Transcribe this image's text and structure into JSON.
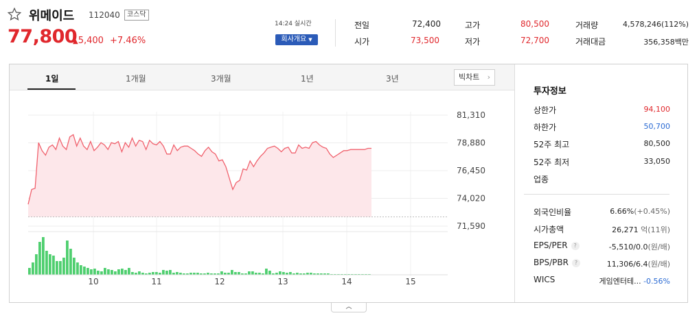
{
  "stock": {
    "name": "위메이드",
    "code": "112040",
    "market": "코스닥",
    "price": "77,800",
    "change": "5,400",
    "change_rate": "+7.46%",
    "realtime_label": "14:24 실시간",
    "company_button": "회사개요"
  },
  "quote": {
    "prev_close_label": "전일",
    "prev_close": "72,400",
    "open_label": "시가",
    "open": "73,500",
    "high_label": "고가",
    "high": "80,500",
    "low_label": "저가",
    "low": "72,700",
    "volume_label": "거래량",
    "volume": "4,578,246(112%)",
    "amount_label": "거래대금",
    "amount": "356,358",
    "amount_unit": "백만"
  },
  "tabs": [
    "1일",
    "1개월",
    "3개월",
    "1년",
    "3년"
  ],
  "big_chart_label": "빅차트",
  "colors": {
    "up": "#e0272c",
    "down": "#2a6ad3",
    "line": "#f0606c",
    "fill": "#fde7ea",
    "volume": "#4fcf6f"
  },
  "chart_data": {
    "type": "line",
    "y_ticks": [
      "81,310",
      "78,880",
      "76,450",
      "74,020",
      "71,590"
    ],
    "ylim": [
      71590,
      81310
    ],
    "x_ticks": [
      "10",
      "11",
      "12",
      "13",
      "14",
      "15"
    ],
    "prev_close_ref": 72400,
    "price_x": [
      0,
      1,
      2,
      3,
      4,
      5,
      6,
      7,
      8,
      9,
      10,
      11,
      12,
      13,
      14,
      15,
      16,
      17,
      18,
      19,
      20,
      21,
      22,
      23,
      24,
      25,
      26,
      27,
      28,
      29,
      30,
      31,
      32,
      33,
      34,
      35,
      36,
      37,
      38,
      39,
      40,
      41,
      42,
      43,
      44,
      45,
      46,
      47,
      48,
      49,
      50,
      51,
      52,
      53,
      54,
      55,
      56,
      57,
      58,
      59,
      60,
      61,
      62,
      63,
      64,
      65,
      66,
      67,
      68,
      69,
      70,
      71,
      72,
      73,
      74,
      75,
      76,
      77,
      78,
      79,
      80,
      81,
      82,
      83,
      84,
      85,
      86,
      87,
      88,
      89,
      90,
      91,
      92,
      93,
      94,
      95,
      96,
      97,
      98,
      99
    ],
    "price": [
      73500,
      74800,
      74900,
      78900,
      78200,
      77800,
      78500,
      78700,
      78300,
      79300,
      78600,
      78300,
      79400,
      79600,
      78600,
      79300,
      78600,
      78300,
      79000,
      78200,
      78500,
      78900,
      78700,
      78300,
      78900,
      78800,
      79000,
      78100,
      78900,
      78500,
      79300,
      78600,
      79100,
      79000,
      78300,
      79100,
      78800,
      78700,
      79000,
      78600,
      77900,
      77900,
      78700,
      78200,
      78500,
      78600,
      78600,
      78400,
      78200,
      77900,
      77700,
      78200,
      78500,
      78100,
      77900,
      77300,
      77400,
      76800,
      75800,
      74800,
      75400,
      75600,
      76600,
      76500,
      77300,
      76800,
      77300,
      77700,
      78000,
      78400,
      78500,
      78600,
      78400,
      78100,
      78400,
      78500,
      78000,
      78000,
      78700,
      78400,
      78500,
      78400,
      78900,
      79000,
      78700,
      78500,
      78400,
      77900,
      77600,
      77800,
      78000,
      78200,
      78200,
      78300,
      78300,
      78300,
      78300,
      78300,
      78400,
      78400
    ],
    "volume_x": [
      0,
      1,
      2,
      3,
      4,
      5,
      6,
      7,
      8,
      9,
      10,
      11,
      12,
      13,
      14,
      15,
      16,
      17,
      18,
      19,
      20,
      21,
      22,
      23,
      24,
      25,
      26,
      27,
      28,
      29,
      30,
      31,
      32,
      33,
      34,
      35,
      36,
      37,
      38,
      39,
      40,
      41,
      42,
      43,
      44,
      45,
      46,
      47,
      48,
      49,
      50,
      51,
      52,
      53,
      54,
      55,
      56,
      57,
      58,
      59,
      60,
      61,
      62,
      63,
      64,
      65,
      66,
      67,
      68,
      69,
      70,
      71,
      72,
      73,
      74,
      75,
      76,
      77,
      78,
      79,
      80,
      81,
      82,
      83,
      84,
      85,
      86,
      87,
      88,
      89,
      90,
      91,
      92,
      93,
      94,
      95,
      96,
      97,
      98,
      99
    ],
    "volume": [
      10,
      18,
      30,
      48,
      55,
      35,
      30,
      28,
      20,
      20,
      25,
      50,
      38,
      25,
      18,
      14,
      12,
      10,
      8,
      9,
      6,
      5,
      10,
      8,
      7,
      5,
      8,
      9,
      7,
      10,
      4,
      3,
      5,
      3,
      2,
      3,
      4,
      4,
      3,
      7,
      6,
      7,
      3,
      4,
      3,
      2,
      2,
      3,
      3,
      3,
      2,
      2,
      3,
      2,
      2,
      2,
      5,
      3,
      3,
      7,
      4,
      4,
      2,
      2,
      5,
      5,
      3,
      3,
      2,
      9,
      6,
      2,
      3,
      5,
      4,
      3,
      4,
      2,
      3,
      2,
      2,
      3,
      3,
      2,
      2,
      2,
      2,
      2,
      1,
      1,
      1,
      1,
      1,
      1,
      1,
      1,
      1,
      1,
      1,
      1
    ],
    "volume_max": 60
  },
  "investment": {
    "title": "투자정보",
    "rows1": [
      {
        "label": "상한가",
        "value": "94,100"
      },
      {
        "label": "하한가",
        "value": "50,700"
      },
      {
        "label": "52주 최고",
        "value": "80,500"
      },
      {
        "label": "52주 최저",
        "value": "33,050"
      },
      {
        "label": "업종",
        "value": ""
      }
    ],
    "rows2": [
      {
        "label": "외국인비율",
        "value": "6.66%",
        "extra": "(+0.45%)"
      },
      {
        "label": "시가총액",
        "value": "26,271",
        "extra": "억(11위)"
      },
      {
        "label": "EPS/PER",
        "value": "-5,510/0.0",
        "extra": "(원/배)"
      },
      {
        "label": "BPS/PBR",
        "value": "11,306/6.4",
        "extra": "(원/배)"
      },
      {
        "label": "WICS",
        "value": "게임엔터테...",
        "extra": "-0.56%"
      }
    ]
  }
}
